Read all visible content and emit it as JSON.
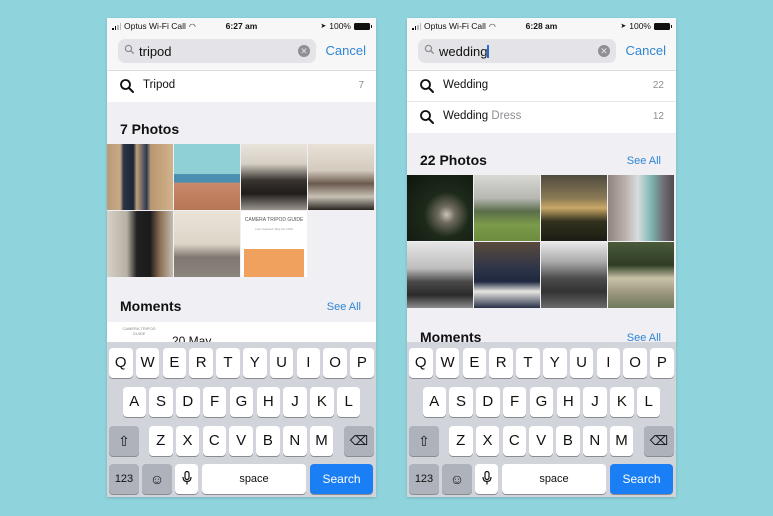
{
  "background_color": "#8fd3dd",
  "phones": [
    {
      "status": {
        "carrier": "Optus Wi-Fi Call",
        "time": "6:27 am",
        "battery": "100%"
      },
      "search": {
        "value": "tripod",
        "cancel": "Cancel",
        "focused": false
      },
      "suggestions": [
        {
          "label": "Tripod",
          "dim": "",
          "count": "7"
        }
      ],
      "photos_title": "7 Photos",
      "photos_see_all": "",
      "photos": [
        {
          "name": "tripod-on-wood"
        },
        {
          "name": "camera-illustration"
        },
        {
          "name": "film-crew"
        },
        {
          "name": "gallery-jumping"
        },
        {
          "name": "camera-on-tripod"
        },
        {
          "name": "tripod-in-room"
        },
        {
          "name": "camera-tripod-guide",
          "title": "CAMERA TRIPOD GUIDE",
          "subtitle": "Last Updated: May 20, 2019"
        }
      ],
      "moments_title": "Moments",
      "moments_see_all": "See All",
      "moment": {
        "date": "20 May",
        "thumb_text": "CAMERA TRIPOD GUIDE"
      }
    },
    {
      "status": {
        "carrier": "Optus Wi-Fi Call",
        "time": "6:28 am",
        "battery": "100%"
      },
      "search": {
        "value": "wedding",
        "cancel": "Cancel",
        "focused": true
      },
      "suggestions": [
        {
          "label": "Wedding",
          "dim": "",
          "count": "22"
        },
        {
          "label": "Wedding",
          "dim": " Dress",
          "count": "12"
        }
      ],
      "photos_title": "22 Photos",
      "photos_see_all": "See All",
      "photos": [
        {
          "name": "couple-embrace"
        },
        {
          "name": "couple-field"
        },
        {
          "name": "couple-sunset"
        },
        {
          "name": "bridesmaids-toast"
        },
        {
          "name": "couple-bw-walk"
        },
        {
          "name": "bridal-party"
        },
        {
          "name": "bride-mountains"
        },
        {
          "name": "couple-kombi-van"
        }
      ],
      "moments_title": "Moments",
      "moments_see_all": "See All"
    }
  ],
  "keyboard": {
    "row1": [
      "Q",
      "W",
      "E",
      "R",
      "T",
      "Y",
      "U",
      "I",
      "O",
      "P"
    ],
    "row2": [
      "A",
      "S",
      "D",
      "F",
      "G",
      "H",
      "J",
      "K",
      "L"
    ],
    "row3": [
      "Z",
      "X",
      "C",
      "V",
      "B",
      "N",
      "M"
    ],
    "shift": "shift-icon",
    "delete": "delete-icon",
    "numbers": "123",
    "emoji": "emoji-icon",
    "mic": "microphone-icon",
    "space": "space",
    "search": "Search"
  }
}
